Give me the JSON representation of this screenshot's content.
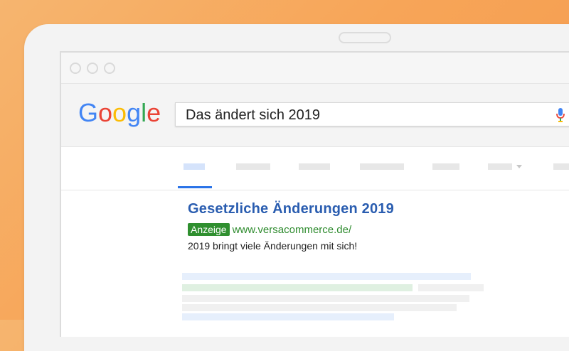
{
  "search": {
    "query": "Das ändert sich 2019"
  },
  "logo": {
    "letters": [
      "G",
      "o",
      "o",
      "g",
      "l",
      "e"
    ],
    "colors": [
      "#4285F4",
      "#EA4335",
      "#FBBC05",
      "#4285F4",
      "#34A853",
      "#EA4335"
    ]
  },
  "result": {
    "title": "Gesetzliche Änderungen 2019",
    "ad_label": "Anzeige",
    "url": "www.versacommerce.de/",
    "description": "2019 bringt viele Änderungen mit sich!"
  },
  "colors": {
    "background": "#f7a558",
    "link_blue": "#2a5db0",
    "ad_green": "#2f8f2f",
    "url_green": "#2e8b2e",
    "active_tab": "#2a73e8"
  }
}
